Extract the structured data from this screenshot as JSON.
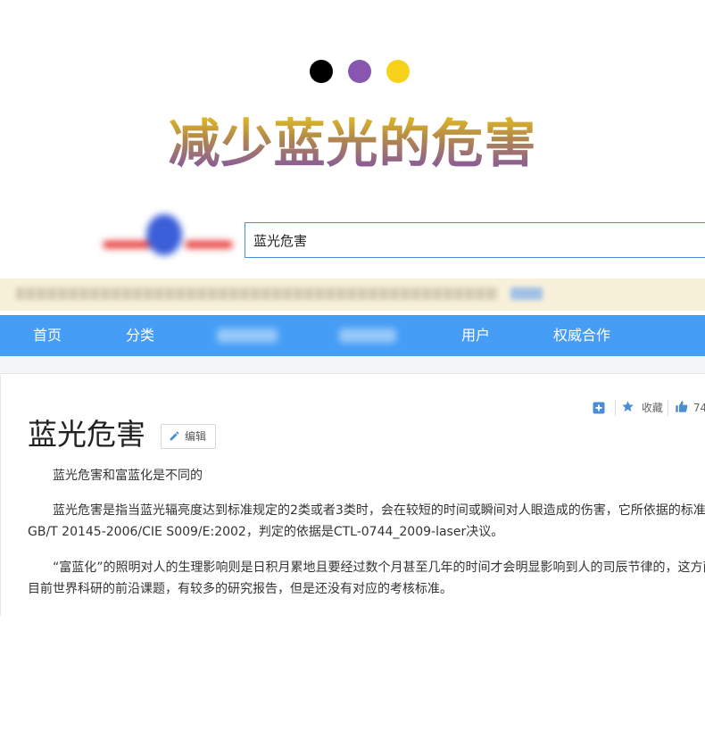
{
  "hero": {
    "title": "减少蓝光的危害",
    "dot_colors": [
      "#000000",
      "#8757b0",
      "#f8d21a"
    ]
  },
  "search": {
    "value": "蓝光危害"
  },
  "navbar": {
    "items": [
      {
        "label": "首页",
        "blurred": false
      },
      {
        "label": "分类",
        "blurred": false
      },
      {
        "label": "",
        "blurred": true
      },
      {
        "label": "",
        "blurred": true
      },
      {
        "label": "用户",
        "blurred": false
      },
      {
        "label": "权威合作",
        "blurred": false
      }
    ]
  },
  "toolbar": {
    "favorite_label": "收藏",
    "like_count": "74",
    "icons": [
      "plus-square-icon",
      "star-icon",
      "thumbs-up-icon"
    ]
  },
  "article": {
    "title": "蓝光危害",
    "edit_label": "编辑",
    "paragraphs": [
      [
        "蓝光危害和富蓝化是不同的"
      ],
      [
        "蓝光危害是指当蓝光辐亮度达到标准规定的2类或者3类时，会在较短的时间或瞬间对人眼造成的伤害，它所依据的标准是",
        "GB/T 20145-2006/CIE S009/E:2002，判定的依据是CTL-0744_2009-laser决议。"
      ],
      [
        "“富蓝化”的照明对人的生理影响则是日积月累地且要经过数个月甚至几年的时间才会明显影响到人的司辰节律的，这方面",
        "目前世界科研的前沿课题，有较多的研究报告，但是还没有对应的考核标准。"
      ]
    ]
  },
  "colors": {
    "nav_bg": "#459df5",
    "notice_bg": "#f8f1da",
    "search_border": "#4a8ed8",
    "icon_blue": "#4a8ed8"
  }
}
